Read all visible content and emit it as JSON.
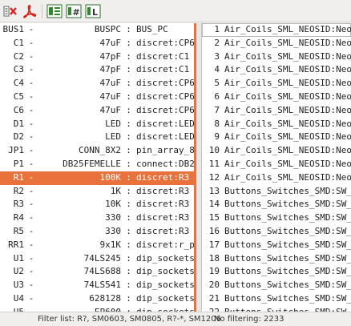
{
  "toolbar": {
    "buttons": [
      {
        "icon": "delete-association-icon"
      },
      {
        "icon": "pdf-icon"
      },
      {
        "icon": "filter-by-keyword-icon"
      },
      {
        "icon": "filter-by-pin-count-icon"
      },
      {
        "icon": "filter-by-library-icon"
      }
    ],
    "accent": "#e9713c"
  },
  "components": [
    {
      "ref": "BUS1",
      "value": "BUSPC",
      "footprint": "BUS_PC"
    },
    {
      "ref": "C1",
      "value": "47uF",
      "footprint": "discret:CP6"
    },
    {
      "ref": "C2",
      "value": "47pF",
      "footprint": "discret:C1"
    },
    {
      "ref": "C3",
      "value": "47pF",
      "footprint": "discret:C1"
    },
    {
      "ref": "C4",
      "value": "47uF",
      "footprint": "discret:CP6"
    },
    {
      "ref": "C5",
      "value": "47uF",
      "footprint": "discret:CP6"
    },
    {
      "ref": "C6",
      "value": "47uF",
      "footprint": "discret:CP6"
    },
    {
      "ref": "D1",
      "value": "LED",
      "footprint": "discret:LEDV"
    },
    {
      "ref": "D2",
      "value": "LED",
      "footprint": "discret:LEDV"
    },
    {
      "ref": "JP1",
      "value": "CONN_8X2",
      "footprint": "pin_array_8x"
    },
    {
      "ref": "P1",
      "value": "DB25FEMELLE",
      "footprint": "connect:DB25"
    },
    {
      "ref": "R1",
      "value": "100K",
      "footprint": "discret:R3",
      "selected": true
    },
    {
      "ref": "R2",
      "value": "1K",
      "footprint": "discret:R3"
    },
    {
      "ref": "R3",
      "value": "10K",
      "footprint": "discret:R3"
    },
    {
      "ref": "R4",
      "value": "330",
      "footprint": "discret:R3"
    },
    {
      "ref": "R5",
      "value": "330",
      "footprint": "discret:R3"
    },
    {
      "ref": "RR1",
      "value": "9x1K",
      "footprint": "discret:r_pa"
    },
    {
      "ref": "U1",
      "value": "74LS245",
      "footprint": "dip_sockets:"
    },
    {
      "ref": "U2",
      "value": "74LS688",
      "footprint": "dip_sockets:"
    },
    {
      "ref": "U3",
      "value": "74LS541",
      "footprint": "dip_sockets:"
    },
    {
      "ref": "U4",
      "value": "628128",
      "footprint": "dip_sockets:"
    },
    {
      "ref": "U5",
      "value": "EP600",
      "footprint": "dip_sockets:"
    }
  ],
  "footprints": [
    {
      "num": "1",
      "name": "Air_Coils_SML_NEOSID:Neos"
    },
    {
      "num": "2",
      "name": "Air_Coils_SML_NEOSID:Neos"
    },
    {
      "num": "3",
      "name": "Air_Coils_SML_NEOSID:Neos"
    },
    {
      "num": "4",
      "name": "Air_Coils_SML_NEOSID:Neos"
    },
    {
      "num": "5",
      "name": "Air_Coils_SML_NEOSID:Neos"
    },
    {
      "num": "6",
      "name": "Air_Coils_SML_NEOSID:Neos"
    },
    {
      "num": "7",
      "name": "Air_Coils_SML_NEOSID:Neos"
    },
    {
      "num": "8",
      "name": "Air_Coils_SML_NEOSID:Neos"
    },
    {
      "num": "9",
      "name": "Air_Coils_SML_NEOSID:Neos"
    },
    {
      "num": "10",
      "name": "Air_Coils_SML_NEOSID:Neos"
    },
    {
      "num": "11",
      "name": "Air_Coils_SML_NEOSID:Neos"
    },
    {
      "num": "12",
      "name": "Air_Coils_SML_NEOSID:Neos"
    },
    {
      "num": "13",
      "name": "Buttons_Switches_SMD:SW_S"
    },
    {
      "num": "14",
      "name": "Buttons_Switches_SMD:SW_S"
    },
    {
      "num": "15",
      "name": "Buttons_Switches_SMD:SW_S"
    },
    {
      "num": "16",
      "name": "Buttons_Switches_SMD:SW_S"
    },
    {
      "num": "17",
      "name": "Buttons_Switches_SMD:SW_S"
    },
    {
      "num": "18",
      "name": "Buttons_Switches_SMD:SW_S"
    },
    {
      "num": "19",
      "name": "Buttons_Switches_SMD:SW_S"
    },
    {
      "num": "20",
      "name": "Buttons_Switches_SMD:SW_S"
    },
    {
      "num": "21",
      "name": "Buttons_Switches_SMD:SW_S"
    },
    {
      "num": "22",
      "name": "Buttons_Switches_SMD:SW_S"
    }
  ],
  "status": {
    "filter_list": "Filter list: R?, SM0603, SM0805, R?-*, SM1206",
    "no_filtering": "No filtering: 2233"
  }
}
